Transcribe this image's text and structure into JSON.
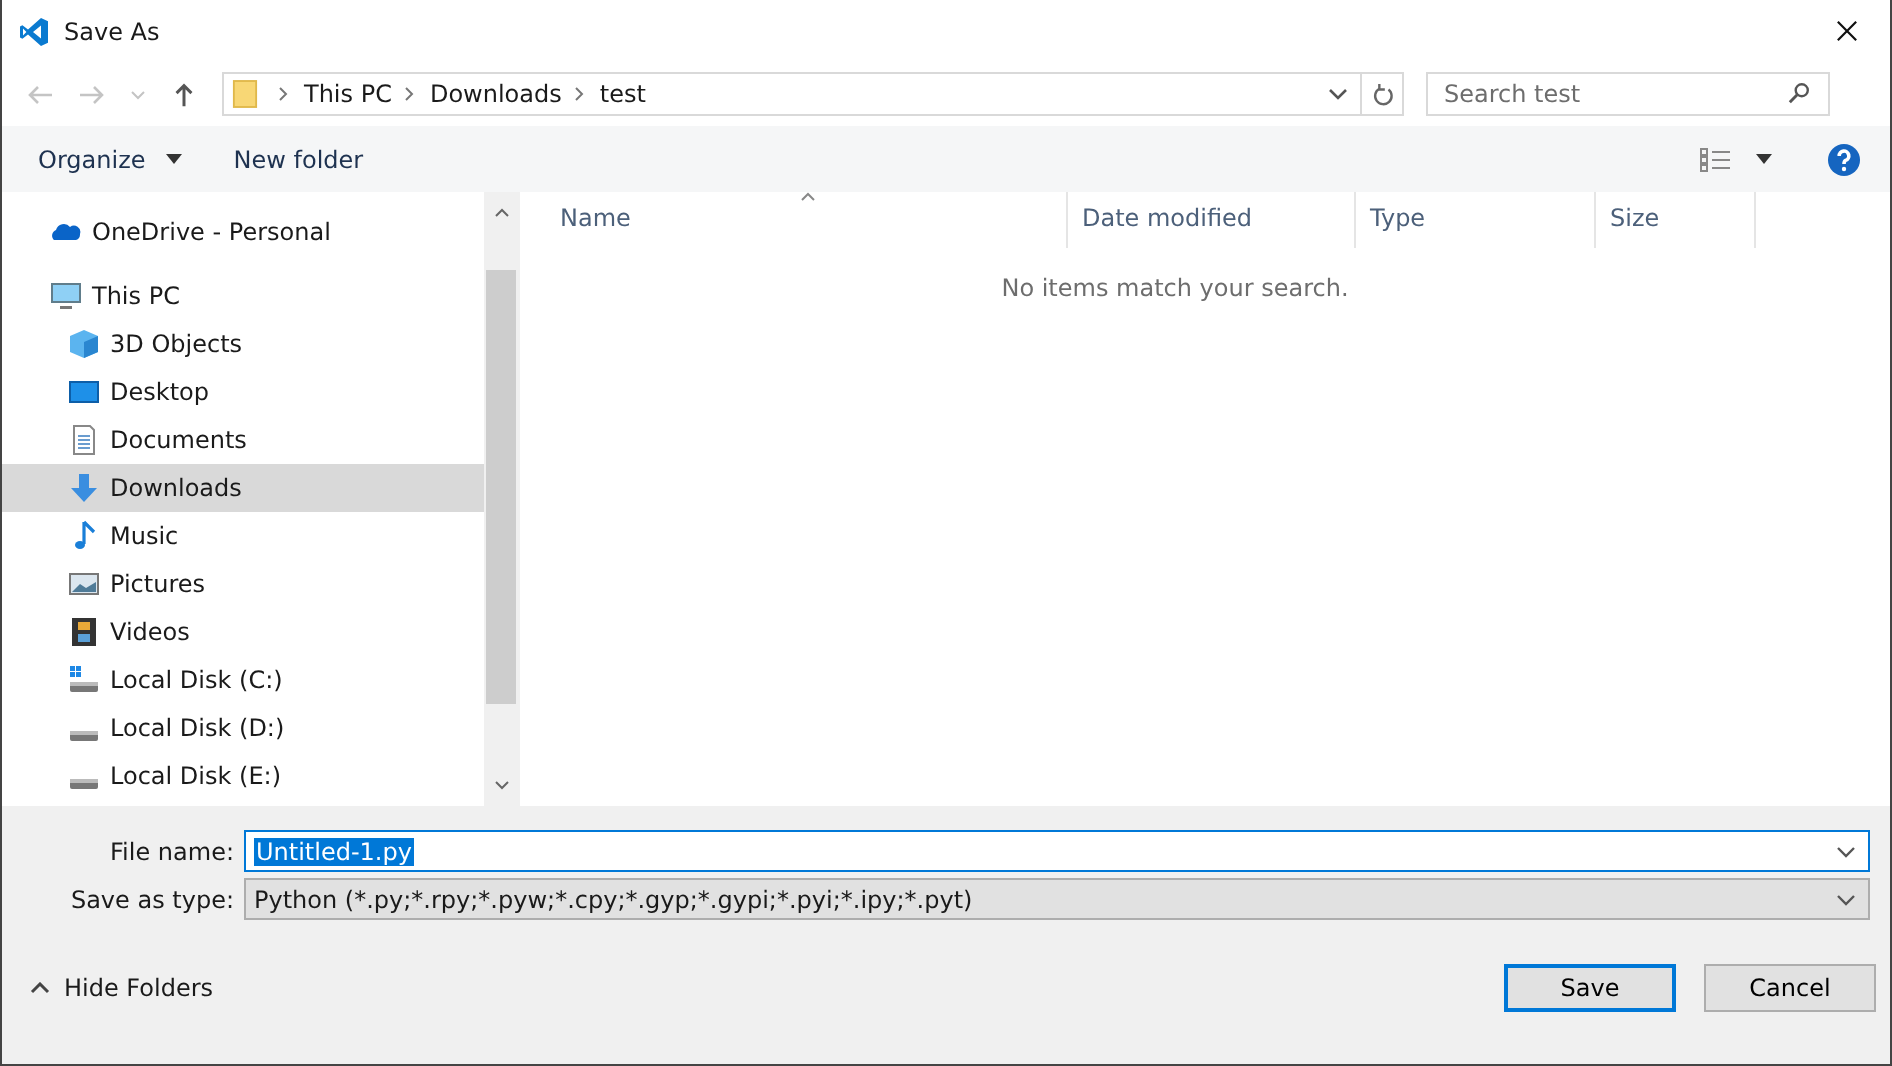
{
  "window": {
    "title": "Save As"
  },
  "address_bar": {
    "segments": [
      "This PC",
      "Downloads",
      "test"
    ]
  },
  "search": {
    "placeholder": "Search test"
  },
  "toolbar": {
    "organize": "Organize",
    "new_folder": "New folder"
  },
  "sidebar": {
    "items": [
      {
        "label": "OneDrive - Personal",
        "kind": "cloud",
        "selected": false
      },
      {
        "label": "This PC",
        "kind": "pc",
        "selected": false,
        "children": [
          {
            "label": "3D Objects",
            "kind": "cube",
            "selected": false
          },
          {
            "label": "Desktop",
            "kind": "desktop",
            "selected": false
          },
          {
            "label": "Documents",
            "kind": "docs",
            "selected": false
          },
          {
            "label": "Downloads",
            "kind": "download",
            "selected": true
          },
          {
            "label": "Music",
            "kind": "music",
            "selected": false
          },
          {
            "label": "Pictures",
            "kind": "pictures",
            "selected": false
          },
          {
            "label": "Videos",
            "kind": "videos",
            "selected": false
          },
          {
            "label": "Local Disk (C:)",
            "kind": "disk-windows",
            "selected": false
          },
          {
            "label": "Local Disk (D:)",
            "kind": "disk",
            "selected": false
          },
          {
            "label": "Local Disk (E:)",
            "kind": "disk",
            "selected": false
          }
        ]
      }
    ]
  },
  "file_list": {
    "columns": [
      {
        "label": "Name",
        "sorted": true
      },
      {
        "label": "Date modified",
        "sorted": false
      },
      {
        "label": "Type",
        "sorted": false
      },
      {
        "label": "Size",
        "sorted": false
      }
    ],
    "empty_message": "No items match your search."
  },
  "form": {
    "file_name_label": "File name:",
    "file_name": "Untitled-1.py",
    "type_label": "Save as type:",
    "type": "Python (*.py;*.rpy;*.pyw;*.cpy;*.gyp;*.gypi;*.pyi;*.ipy;*.pyt)"
  },
  "hide_folders": "Hide Folders",
  "buttons": [
    {
      "label": "Save",
      "kind": "default"
    },
    {
      "label": "Cancel",
      "kind": "normal"
    }
  ]
}
